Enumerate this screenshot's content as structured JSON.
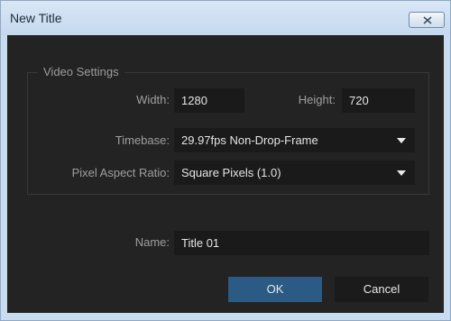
{
  "window": {
    "title": "New Title"
  },
  "video_settings": {
    "group_label": "Video Settings",
    "width_label": "Width:",
    "width_value": "1280",
    "height_label": "Height:",
    "height_value": "720",
    "timebase_label": "Timebase:",
    "timebase_value": "29.97fps Non-Drop-Frame",
    "par_label": "Pixel Aspect Ratio:",
    "par_value": "Square Pixels (1.0)"
  },
  "name": {
    "label": "Name:",
    "value": "Title 01"
  },
  "buttons": {
    "ok": "OK",
    "cancel": "Cancel"
  },
  "colors": {
    "dialog_bg": "#232323",
    "field_bg": "#1a1a1a",
    "ok_accent": "#2b5b84",
    "titlebar": "#c9dcef"
  },
  "icons": {
    "close": "close-x-icon",
    "dropdown": "triangle-down-icon"
  }
}
